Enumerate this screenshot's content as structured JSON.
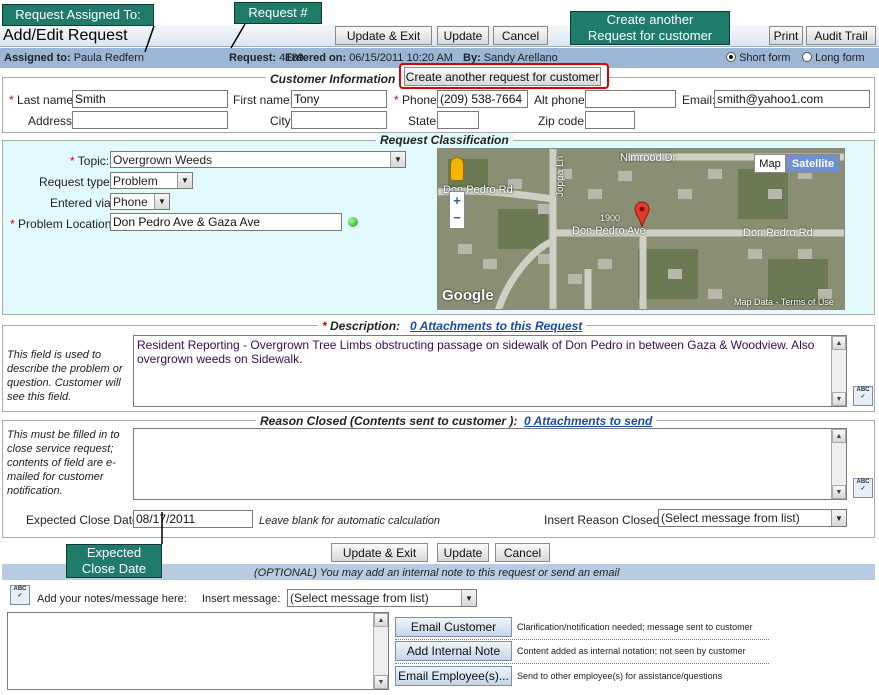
{
  "callouts": {
    "assigned": "Request Assigned To:",
    "request_num": "Request #",
    "create_another": "Create another Request for customer",
    "expected_close": "Expected Close Date"
  },
  "page": {
    "title": "Add/Edit Request"
  },
  "toolbar": {
    "update_exit": "Update & Exit",
    "update": "Update",
    "cancel": "Cancel",
    "print": "Print",
    "audit": "Audit Trail"
  },
  "info": {
    "assigned_label": "Assigned to:",
    "assigned_value": "Paula Redfern",
    "request_label": "Request:",
    "request_value": "4189",
    "entered_label": "Entered on:",
    "entered_value": "06/15/2011 10:20 AM",
    "by_label": "By:",
    "by_value": "Sandy Arellano",
    "short_form": "Short form",
    "long_form": "Long form"
  },
  "customer": {
    "heading": "Customer Information",
    "create_another_btn": "Create another request for customer",
    "last_name_label": "Last name:",
    "last_name": "Smith",
    "first_name_label": "First name:",
    "first_name": "Tony",
    "phone_label": "Phone:",
    "phone": "(209) 538-7664",
    "alt_phone_label": "Alt phone:",
    "alt_phone": "",
    "email_label": "Email:",
    "email": "smith@yahoo1.com",
    "address_label": "Address:",
    "city_label": "City:",
    "state_label": "State:",
    "zip_label": "Zip code:"
  },
  "classification": {
    "heading": "Request Classification",
    "topic_label": "Topic:",
    "topic": "Overgrown Weeds",
    "type_label": "Request type:",
    "type": "Problem",
    "via_label": "Entered via:",
    "via": "Phone",
    "location_label": "Problem Location:",
    "location": "Don Pedro Ave & Gaza Ave"
  },
  "map": {
    "map_btn": "Map",
    "satellite_btn": "Satellite",
    "streets": [
      "Nimrood Dr",
      "Don Pedro Ave",
      "Don Pedro Rd",
      "Don Pedro Rd",
      "Joppa Ln",
      "1900"
    ],
    "logo": "Google",
    "terms": "Map Data - Terms of Use",
    "zoom_in": "+",
    "zoom_out": "−"
  },
  "description": {
    "heading": "Description:",
    "attachments": "0 Attachments to this Request",
    "help": "This field is used to describe the problem or question. Customer will see this field.",
    "text": "Resident Reporting - Overgrown Tree Limbs obstructing passage on sidewalk of Don Pedro in between Gaza & Woodview. Also overgrown weeds on Sidewalk."
  },
  "reason": {
    "heading": "Reason Closed (Contents sent to customer ):",
    "attachments": "0 Attachments to send",
    "help": "This must be filled in to close service request; contents of field are e-mailed for customer notification.",
    "close_date_label": "Expected Close Date:",
    "close_date": "08/17/2011",
    "blank_hint": "Leave blank for automatic calculation",
    "insert_label": "Insert Reason Closed:",
    "insert_value": "(Select message from list)"
  },
  "bottom": {
    "update_exit": "Update & Exit",
    "update": "Update",
    "cancel": "Cancel",
    "optional": "(OPTIONAL) You may add an internal note to this request or send an email",
    "notes_label": "Add your notes/message here:",
    "insert_label": "Insert message:",
    "insert_value": "(Select message from list)",
    "email_customer": "Email Customer",
    "email_customer_desc": "Clarification/notification needed; message sent to customer",
    "add_note": "Add Internal Note",
    "add_note_desc": "Content added as internal notation; not seen by customer",
    "email_employee": "Email Employee(s)...",
    "email_employee_desc": "Send to other employee(s) for assistance/questions"
  },
  "colors": {
    "callout_bg": "#1f7c6b",
    "info_bar": "#9cb6d6",
    "class_bg": "#e2fafc",
    "highlight": "#e00000"
  }
}
